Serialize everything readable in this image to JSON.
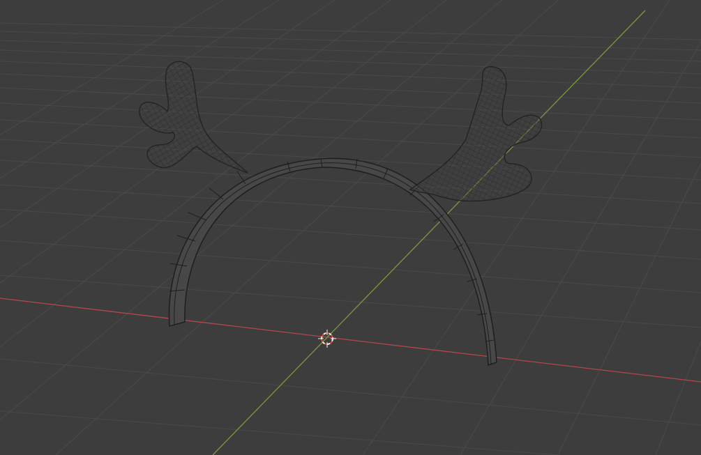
{
  "viewport": {
    "background": "#3d3d3d",
    "grid_color": "#4a4a4a",
    "x_axis_color": "#b3484c",
    "y_axis_color": "#7c9a3a",
    "mesh_fill": "#464646",
    "wire_color": "#1e1e1e",
    "cursor_colors": [
      "#d64b3b",
      "#f2f2f2"
    ]
  },
  "scene_objects": [
    "headband",
    "antler-left",
    "antler-right"
  ],
  "tools": [
    "3d-cursor-icon"
  ]
}
